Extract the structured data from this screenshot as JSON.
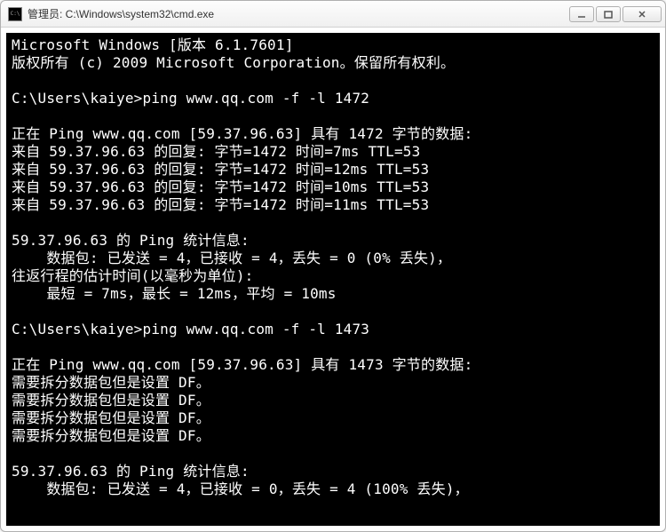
{
  "titlebar": {
    "title": "管理员: C:\\Windows\\system32\\cmd.exe"
  },
  "console": {
    "lines": [
      "Microsoft Windows [版本 6.1.7601]",
      "版权所有 (c) 2009 Microsoft Corporation。保留所有权利。",
      "",
      "C:\\Users\\kaiye>ping www.qq.com -f -l 1472",
      "",
      "正在 Ping www.qq.com [59.37.96.63] 具有 1472 字节的数据:",
      "来自 59.37.96.63 的回复: 字节=1472 时间=7ms TTL=53",
      "来自 59.37.96.63 的回复: 字节=1472 时间=12ms TTL=53",
      "来自 59.37.96.63 的回复: 字节=1472 时间=10ms TTL=53",
      "来自 59.37.96.63 的回复: 字节=1472 时间=11ms TTL=53",
      "",
      "59.37.96.63 的 Ping 统计信息:",
      "    数据包: 已发送 = 4，已接收 = 4，丢失 = 0 (0% 丢失)，",
      "往返行程的估计时间(以毫秒为单位):",
      "    最短 = 7ms，最长 = 12ms，平均 = 10ms",
      "",
      "C:\\Users\\kaiye>ping www.qq.com -f -l 1473",
      "",
      "正在 Ping www.qq.com [59.37.96.63] 具有 1473 字节的数据:",
      "需要拆分数据包但是设置 DF。",
      "需要拆分数据包但是设置 DF。",
      "需要拆分数据包但是设置 DF。",
      "需要拆分数据包但是设置 DF。",
      "",
      "59.37.96.63 的 Ping 统计信息:",
      "    数据包: 已发送 = 4，已接收 = 0，丢失 = 4 (100% 丢失)，"
    ]
  }
}
